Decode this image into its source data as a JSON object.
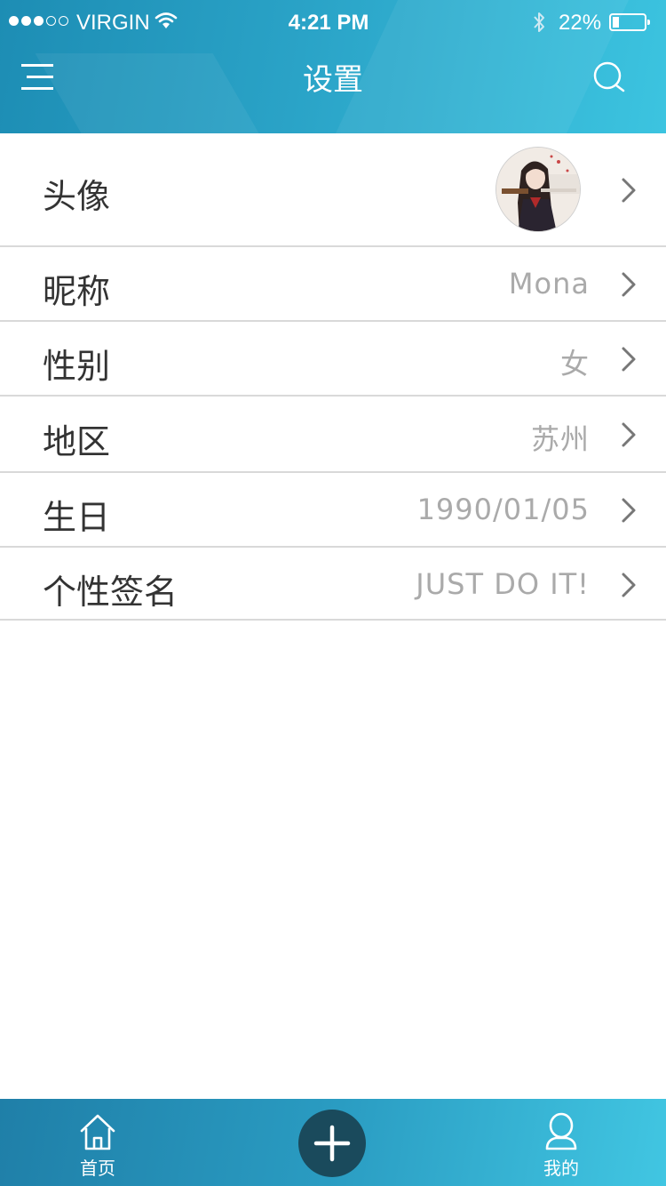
{
  "status_bar": {
    "carrier": "VIRGIN",
    "time": "4:21 PM",
    "battery_text": "22%",
    "battery_level": 0.22,
    "signal_bars_filled": 3,
    "signal_bars_total": 5
  },
  "header": {
    "title": "设置"
  },
  "settings": {
    "rows": [
      {
        "label": "头像",
        "value": ""
      },
      {
        "label": "昵称",
        "value": "Mona"
      },
      {
        "label": "性别",
        "value": "女"
      },
      {
        "label": "地区",
        "value": "苏州"
      },
      {
        "label": "生日",
        "value": "1990/01/05"
      },
      {
        "label": "个性签名",
        "value": "JUST DO IT!"
      }
    ]
  },
  "tabbar": {
    "home_label": "首页",
    "mine_label": "我的"
  },
  "colors": {
    "header_start": "#1d8db4",
    "header_end": "#3cc4e0",
    "add_button": "#1a4a5c",
    "label_text": "#333333",
    "value_text": "#aaaaaa",
    "divider": "#d9d9d9"
  },
  "icons": {
    "menu": "menu-icon",
    "search": "search-icon",
    "chevron": "chevron-right-icon",
    "home": "home-icon",
    "add": "plus-icon",
    "profile": "user-icon",
    "wifi": "wifi-icon",
    "bluetooth": "bluetooth-icon",
    "battery": "battery-icon"
  }
}
